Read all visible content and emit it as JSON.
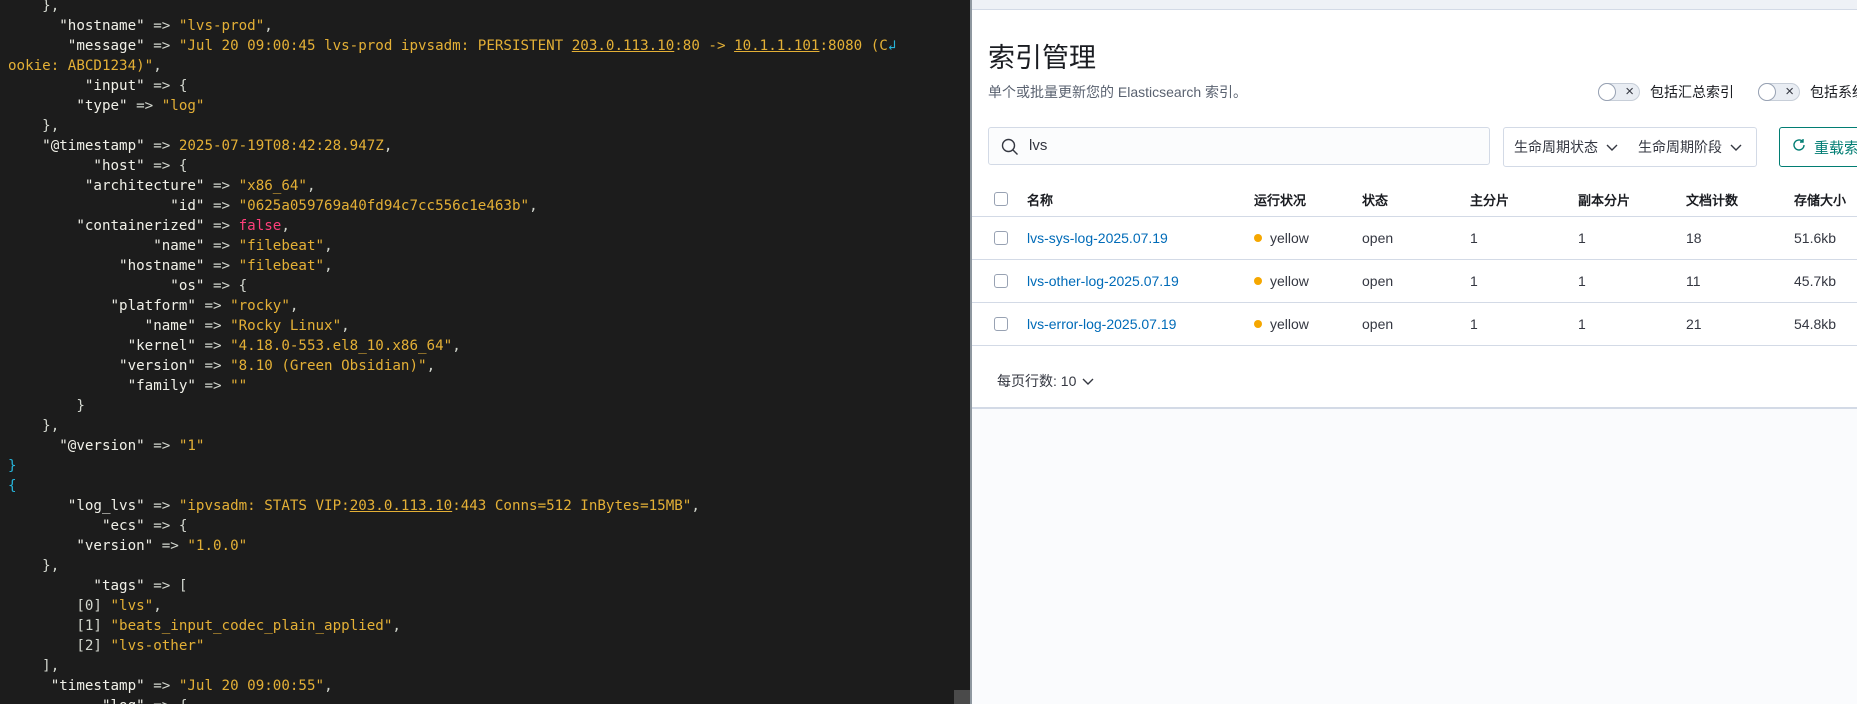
{
  "terminal": {
    "lines": [
      [
        {
          "t": "    },",
          "c": "o"
        }
      ],
      [
        {
          "t": "      \"hostname\"",
          "c": "k"
        },
        {
          "t": " => ",
          "c": "o"
        },
        {
          "t": "\"lvs-prod\"",
          "c": "s"
        },
        {
          "t": ",",
          "c": "o"
        }
      ],
      [
        {
          "t": "       \"message\"",
          "c": "k"
        },
        {
          "t": " => ",
          "c": "o"
        },
        {
          "t": "\"Jul 20 09:00:45 lvs-prod ipvsadm: PERSISTENT ",
          "c": "s"
        },
        {
          "t": "203.0.113.10",
          "c": "u"
        },
        {
          "t": ":80 -> ",
          "c": "s"
        },
        {
          "t": "10.1.1.101",
          "c": "u"
        },
        {
          "t": ":8080 (C",
          "c": "s"
        },
        {
          "t": "↲",
          "c": "wr"
        }
      ],
      [
        {
          "t": "ookie: ABCD1234)\"",
          "c": "s"
        },
        {
          "t": ",",
          "c": "o"
        }
      ],
      [
        {
          "t": "         \"input\"",
          "c": "k"
        },
        {
          "t": " => {",
          "c": "o"
        }
      ],
      [
        {
          "t": "        \"type\"",
          "c": "k"
        },
        {
          "t": " => ",
          "c": "o"
        },
        {
          "t": "\"log\"",
          "c": "s"
        }
      ],
      [
        {
          "t": "    },",
          "c": "o"
        }
      ],
      [
        {
          "t": "    \"@timestamp\"",
          "c": "k"
        },
        {
          "t": " => ",
          "c": "o"
        },
        {
          "t": "2025-07-19T08:42:28.947Z",
          "c": "s"
        },
        {
          "t": ",",
          "c": "o"
        }
      ],
      [
        {
          "t": "          \"host\"",
          "c": "k"
        },
        {
          "t": " => {",
          "c": "o"
        }
      ],
      [
        {
          "t": "         \"architecture\"",
          "c": "k"
        },
        {
          "t": " => ",
          "c": "o"
        },
        {
          "t": "\"x86_64\"",
          "c": "s"
        },
        {
          "t": ",",
          "c": "o"
        }
      ],
      [
        {
          "t": "                   \"id\"",
          "c": "k"
        },
        {
          "t": " => ",
          "c": "o"
        },
        {
          "t": "\"0625a059769a40fd94c7cc556c1e463b\"",
          "c": "s"
        },
        {
          "t": ",",
          "c": "o"
        }
      ],
      [
        {
          "t": "        \"containerized\"",
          "c": "k"
        },
        {
          "t": " => ",
          "c": "o"
        },
        {
          "t": "false",
          "c": "b"
        },
        {
          "t": ",",
          "c": "o"
        }
      ],
      [
        {
          "t": "                 \"name\"",
          "c": "k"
        },
        {
          "t": " => ",
          "c": "o"
        },
        {
          "t": "\"filebeat\"",
          "c": "s"
        },
        {
          "t": ",",
          "c": "o"
        }
      ],
      [
        {
          "t": "             \"hostname\"",
          "c": "k"
        },
        {
          "t": " => ",
          "c": "o"
        },
        {
          "t": "\"filebeat\"",
          "c": "s"
        },
        {
          "t": ",",
          "c": "o"
        }
      ],
      [
        {
          "t": "                   \"os\"",
          "c": "k"
        },
        {
          "t": " => {",
          "c": "o"
        }
      ],
      [
        {
          "t": "            \"platform\"",
          "c": "k"
        },
        {
          "t": " => ",
          "c": "o"
        },
        {
          "t": "\"rocky\"",
          "c": "s"
        },
        {
          "t": ",",
          "c": "o"
        }
      ],
      [
        {
          "t": "                \"name\"",
          "c": "k"
        },
        {
          "t": " => ",
          "c": "o"
        },
        {
          "t": "\"Rocky Linux\"",
          "c": "s"
        },
        {
          "t": ",",
          "c": "o"
        }
      ],
      [
        {
          "t": "              \"kernel\"",
          "c": "k"
        },
        {
          "t": " => ",
          "c": "o"
        },
        {
          "t": "\"4.18.0-553.el8_10.x86_64\"",
          "c": "s"
        },
        {
          "t": ",",
          "c": "o"
        }
      ],
      [
        {
          "t": "             \"version\"",
          "c": "k"
        },
        {
          "t": " => ",
          "c": "o"
        },
        {
          "t": "\"8.10 (Green Obsidian)\"",
          "c": "s"
        },
        {
          "t": ",",
          "c": "o"
        }
      ],
      [
        {
          "t": "              \"family\"",
          "c": "k"
        },
        {
          "t": " => ",
          "c": "o"
        },
        {
          "t": "\"\"",
          "c": "s"
        }
      ],
      [
        {
          "t": "        }",
          "c": "o"
        }
      ],
      [
        {
          "t": "    },",
          "c": "o"
        }
      ],
      [
        {
          "t": "      \"@version\"",
          "c": "k"
        },
        {
          "t": " => ",
          "c": "o"
        },
        {
          "t": "\"1\"",
          "c": "s"
        }
      ],
      [
        {
          "t": "}",
          "c": "br"
        }
      ],
      [
        {
          "t": "{",
          "c": "br"
        }
      ],
      [
        {
          "t": "       \"log_lvs\"",
          "c": "k"
        },
        {
          "t": " => ",
          "c": "o"
        },
        {
          "t": "\"ipvsadm: STATS VIP:",
          "c": "s"
        },
        {
          "t": "203.0.113.10",
          "c": "u"
        },
        {
          "t": ":443 Conns=512 InBytes=15MB\"",
          "c": "s"
        },
        {
          "t": ",",
          "c": "o"
        }
      ],
      [
        {
          "t": "           \"ecs\"",
          "c": "k"
        },
        {
          "t": " => {",
          "c": "o"
        }
      ],
      [
        {
          "t": "        \"version\"",
          "c": "k"
        },
        {
          "t": " => ",
          "c": "o"
        },
        {
          "t": "\"1.0.0\"",
          "c": "s"
        }
      ],
      [
        {
          "t": "    },",
          "c": "o"
        }
      ],
      [
        {
          "t": "          \"tags\"",
          "c": "k"
        },
        {
          "t": " => [",
          "c": "o"
        }
      ],
      [
        {
          "t": "        [0] ",
          "c": "o"
        },
        {
          "t": "\"lvs\"",
          "c": "s"
        },
        {
          "t": ",",
          "c": "o"
        }
      ],
      [
        {
          "t": "        [1] ",
          "c": "o"
        },
        {
          "t": "\"beats_input_codec_plain_applied\"",
          "c": "s"
        },
        {
          "t": ",",
          "c": "o"
        }
      ],
      [
        {
          "t": "        [2] ",
          "c": "o"
        },
        {
          "t": "\"lvs-other\"",
          "c": "s"
        }
      ],
      [
        {
          "t": "    ],",
          "c": "o"
        }
      ],
      [
        {
          "t": "     \"timestamp\"",
          "c": "k"
        },
        {
          "t": " => ",
          "c": "o"
        },
        {
          "t": "\"Jul 20 09:00:55\"",
          "c": "s"
        },
        {
          "t": ",",
          "c": "o"
        }
      ],
      [
        {
          "t": "           \"log\"",
          "c": "k"
        },
        {
          "t": " => {",
          "c": "o"
        }
      ]
    ]
  },
  "kibana": {
    "title": "索引管理",
    "subtitle": "单个或批量更新您的 Elasticsearch 索引。",
    "toggles": [
      {
        "label": "包括汇总索引"
      },
      {
        "label": "包括系统"
      }
    ],
    "search": {
      "value": "lvs"
    },
    "filters": {
      "lifecycle_status": "生命周期状态",
      "lifecycle_phase": "生命周期阶段"
    },
    "reload_label": "重载索",
    "table": {
      "headers": [
        "名称",
        "运行状况",
        "状态",
        "主分片",
        "副本分片",
        "文档计数",
        "存储大小"
      ],
      "rows": [
        {
          "name": "lvs-sys-log-2025.07.19",
          "health": "yellow",
          "status": "open",
          "primary": "1",
          "replica": "1",
          "docs": "18",
          "size": "51.6kb"
        },
        {
          "name": "lvs-other-log-2025.07.19",
          "health": "yellow",
          "status": "open",
          "primary": "1",
          "replica": "1",
          "docs": "11",
          "size": "45.7kb"
        },
        {
          "name": "lvs-error-log-2025.07.19",
          "health": "yellow",
          "status": "open",
          "primary": "1",
          "replica": "1",
          "docs": "21",
          "size": "54.8kb"
        }
      ]
    },
    "pagination": {
      "rows_per_page": "每页行数: 10"
    },
    "colors": {
      "health_yellow": "#f5a700",
      "link": "#006bb8",
      "accent": "#017d73"
    }
  }
}
